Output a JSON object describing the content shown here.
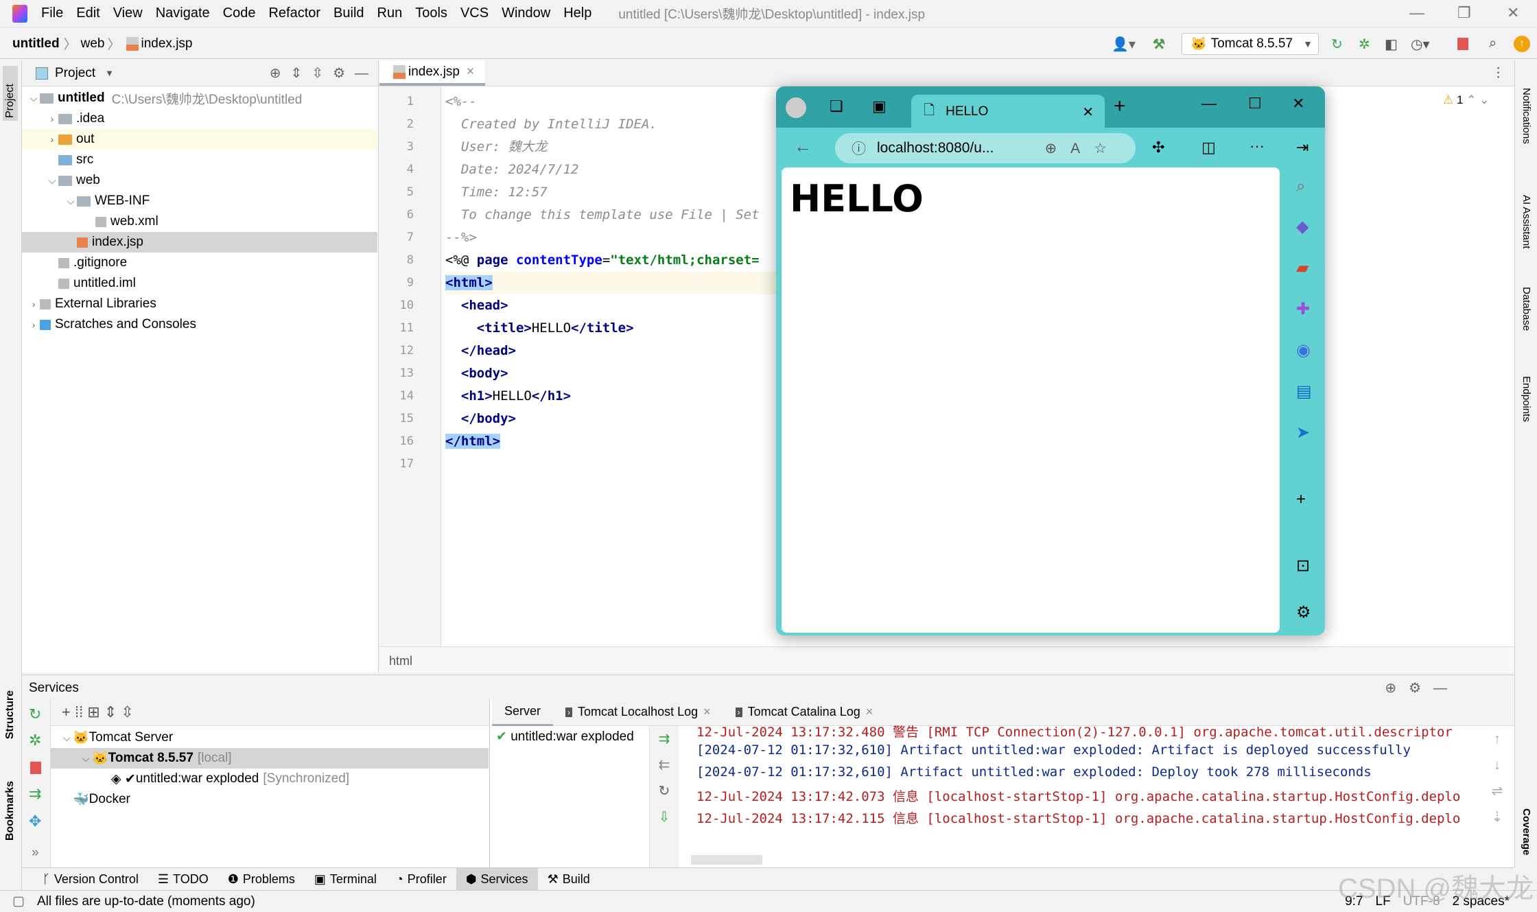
{
  "menu": {
    "items": [
      "File",
      "Edit",
      "View",
      "Navigate",
      "Code",
      "Refactor",
      "Build",
      "Run",
      "Tools",
      "VCS",
      "Window",
      "Help"
    ],
    "window_title": "untitled [C:\\Users\\魏帅龙\\Desktop\\untitled] - index.jsp"
  },
  "breadcrumb": [
    "untitled",
    "web",
    "index.jsp"
  ],
  "toolbar": {
    "run_config": "Tomcat 8.5.57"
  },
  "left_strip": {
    "project": "Project",
    "structure": "Structure",
    "bookmarks": "Bookmarks"
  },
  "right_strip": [
    "Notifications",
    "AI Assistant",
    "Database",
    "Endpoints",
    "Coverage"
  ],
  "project": {
    "header": "Project",
    "tree": [
      {
        "label": "untitled",
        "extra": "C:\\Users\\魏帅龙\\Desktop\\untitled",
        "depth": 0,
        "expanded": true,
        "icon": "module-folder"
      },
      {
        "label": ".idea",
        "depth": 1,
        "expanded": false,
        "icon": "folder"
      },
      {
        "label": "out",
        "depth": 1,
        "expanded": false,
        "icon": "excluded-folder",
        "highlight": true
      },
      {
        "label": "src",
        "depth": 1,
        "icon": "source-folder"
      },
      {
        "label": "web",
        "depth": 1,
        "expanded": true,
        "icon": "web-folder"
      },
      {
        "label": "WEB-INF",
        "depth": 2,
        "expanded": true,
        "icon": "folder"
      },
      {
        "label": "web.xml",
        "depth": 3,
        "icon": "xml-file"
      },
      {
        "label": "index.jsp",
        "depth": 2,
        "icon": "jsp-file",
        "selected": true
      },
      {
        "label": ".gitignore",
        "depth": 1,
        "icon": "ignore-file"
      },
      {
        "label": "untitled.iml",
        "depth": 1,
        "icon": "iml-file"
      },
      {
        "label": "External Libraries",
        "depth": 0,
        "expanded": false,
        "icon": "library"
      },
      {
        "label": "Scratches and Consoles",
        "depth": 0,
        "expanded": false,
        "icon": "scratches"
      }
    ]
  },
  "editor": {
    "tab": "index.jsp",
    "warning_count": "1",
    "breadcrumb": "html",
    "line_numbers": [
      "1",
      "2",
      "3",
      "4",
      "5",
      "6",
      "7",
      "8",
      "9",
      "10",
      "11",
      "12",
      "13",
      "14",
      "15",
      "16",
      "17"
    ],
    "lines": [
      "<%--",
      "  Created by IntelliJ IDEA.",
      "  User: 魏大龙",
      "  Date: 2024/7/12",
      "  Time: 12:57",
      "  To change this template use File | Set",
      "--%>",
      "<%@ page contentType=\"text/html;charset=",
      "<html>",
      "  <head>",
      "    <title>HELLO</title>",
      "  </head>",
      "  <body>",
      "  <h1>HELLO</h1>",
      "  </body>",
      "</html>",
      ""
    ]
  },
  "browser": {
    "tab_title": "HELLO",
    "url": "localhost:8080/u...",
    "heading": "HELLO",
    "theme_color": "#61d1d2"
  },
  "services": {
    "title": "Services",
    "tree": [
      {
        "label": "Tomcat Server",
        "depth": 0
      },
      {
        "label": "Tomcat 8.5.57",
        "extra": "[local]",
        "depth": 1,
        "selected": true
      },
      {
        "label": "untitled:war exploded",
        "extra": "[Synchronized]",
        "depth": 2
      },
      {
        "label": "Docker",
        "depth": 0
      }
    ],
    "tabs": [
      "Server",
      "Tomcat Localhost Log",
      "Tomcat Catalina Log"
    ],
    "deployment": "untitled:war exploded",
    "log": [
      {
        "text": "12-Jul-2024 13:17:32.480 警告 [RMI TCP Connection(2)-127.0.0.1] org.apache.tomcat.util.descriptor",
        "color": "red"
      },
      {
        "text": "[2024-07-12 01:17:32,610] Artifact untitled:war exploded: Artifact is deployed successfully",
        "color": "navy"
      },
      {
        "text": "[2024-07-12 01:17:32,610] Artifact untitled:war exploded: Deploy took 278 milliseconds",
        "color": "navy"
      },
      {
        "text": "12-Jul-2024 13:17:42.073 信息 [localhost-startStop-1] org.apache.catalina.startup.HostConfig.deplo",
        "color": "red"
      },
      {
        "text": "12-Jul-2024 13:17:42.115 信息 [localhost-startStop-1] org.apache.catalina.startup.HostConfig.deplo",
        "color": "red"
      }
    ]
  },
  "tool_tabs": [
    "Version Control",
    "TODO",
    "Problems",
    "Terminal",
    "Profiler",
    "Services",
    "Build"
  ],
  "status": {
    "message": "All files are up-to-date (moments ago)",
    "position": "9:7",
    "line_sep": "LF",
    "encoding": "UTF-8",
    "indent": "2 spaces*"
  },
  "watermark": "CSDN @魏大龙"
}
